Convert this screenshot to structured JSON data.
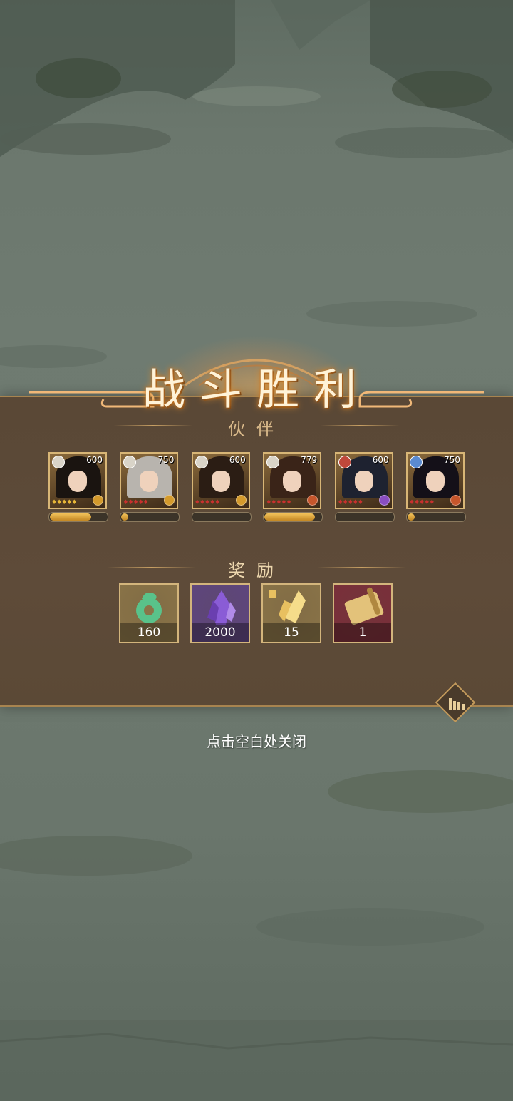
{
  "title": "战斗胜利",
  "subtitle": "伙伴",
  "heroes": [
    {
      "level": "600",
      "element_color": "#d9d4c8",
      "star_color": "#e8b838",
      "stars": 5,
      "rank_color": "#d49a2c",
      "exp_fraction": 0.73,
      "hair": "#1a1410"
    },
    {
      "level": "750",
      "element_color": "#d9d4c8",
      "star_color": "#c8312e",
      "stars": 5,
      "rank_color": "#d49a2c",
      "exp_fraction": 0.12,
      "hair": "#b8b4ae"
    },
    {
      "level": "600",
      "element_color": "#d9d4c8",
      "star_color": "#c8312e",
      "stars": 5,
      "rank_color": "#d49a2c",
      "exp_fraction": 0.0,
      "hair": "#2b1d14"
    },
    {
      "level": "779",
      "element_color": "#d9d4c8",
      "star_color": "#c8312e",
      "stars": 5,
      "rank_color": "#c6562c",
      "exp_fraction": 0.88,
      "hair": "#3a2418"
    },
    {
      "level": "600",
      "element_color": "#c0483a",
      "star_color": "#c8312e",
      "stars": 5,
      "rank_color": "#8a4ec2",
      "exp_fraction": 0.0,
      "hair": "#1e2230"
    },
    {
      "level": "750",
      "element_color": "#5a8ad0",
      "star_color": "#c8312e",
      "stars": 5,
      "rank_color": "#c6562c",
      "exp_fraction": 0.12,
      "hair": "#141018"
    }
  ],
  "rewards_title": "奖励",
  "rewards": [
    {
      "name": "jade-pendant-icon",
      "qty": "160",
      "bg": "#8a7448",
      "tint": "#59c28a"
    },
    {
      "name": "purple-crystal-icon",
      "qty": "2000",
      "bg": "#5e4680",
      "tint": "#8a5cd6"
    },
    {
      "name": "golden-fragment-icon",
      "qty": "15",
      "bg": "#8a7448",
      "tint": "#f5dc8a"
    },
    {
      "name": "scroll-icon",
      "qty": "1",
      "bg": "#7a2e3a",
      "tint": "#e3c27a"
    }
  ],
  "hint": "点击空白处关闭",
  "stats_icon": "bar-chart-icon"
}
